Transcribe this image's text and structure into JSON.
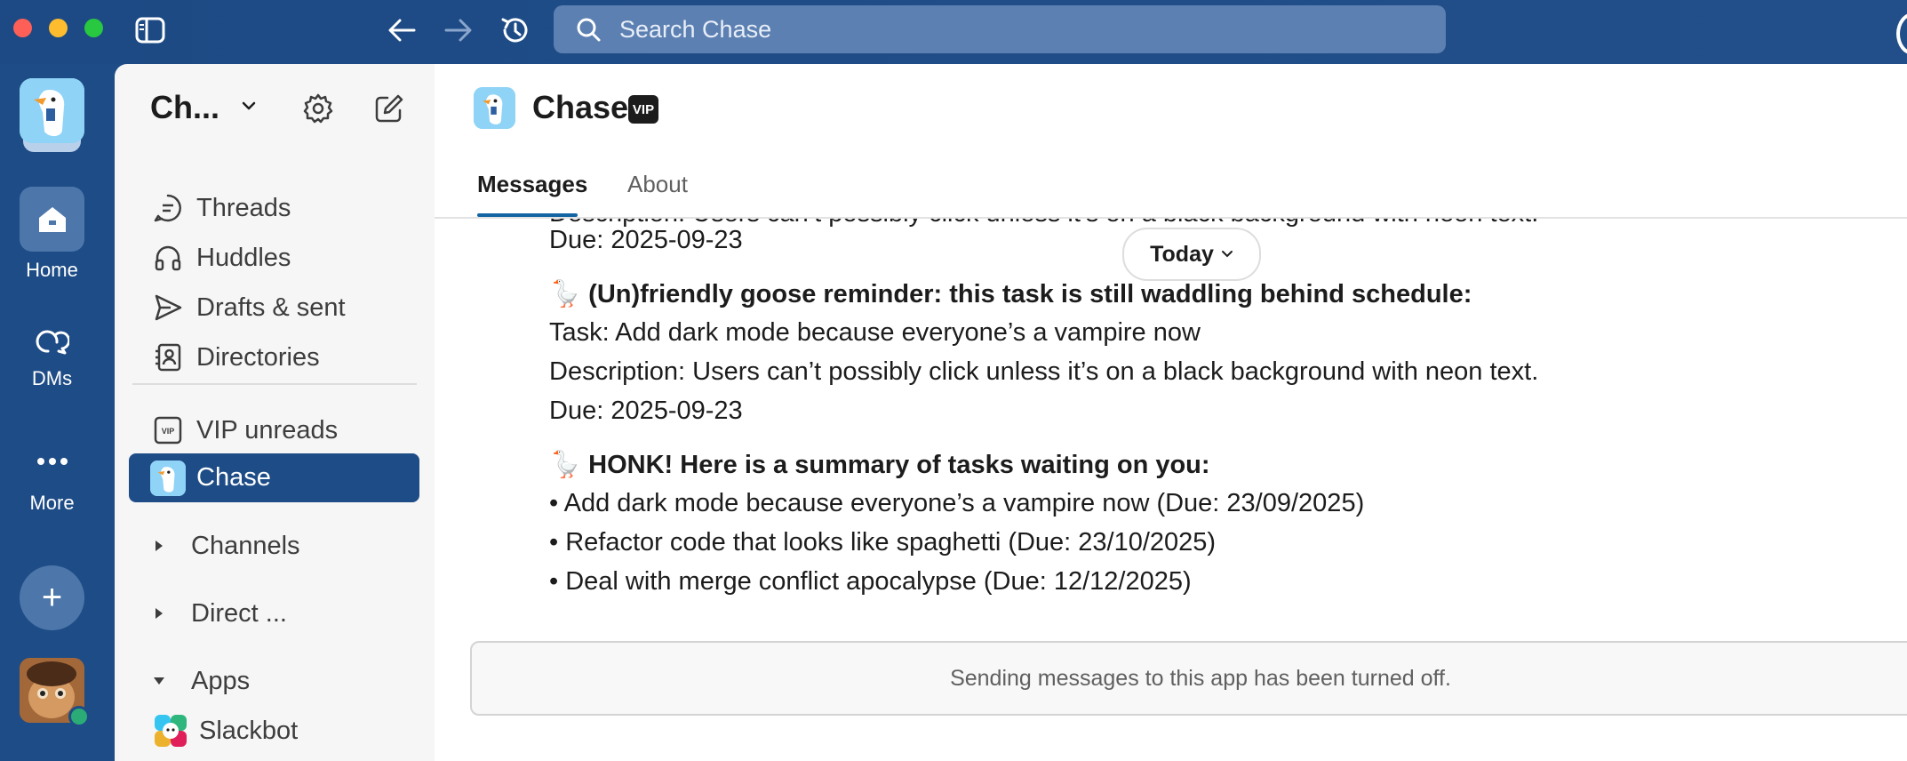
{
  "titlebar": {
    "search_placeholder": "Search Chase",
    "icons": [
      "sidebar-toggle-icon",
      "back-arrow-icon",
      "forward-arrow-icon",
      "history-icon",
      "search-icon"
    ]
  },
  "rail": {
    "home_label": "Home",
    "dms_label": "DMs",
    "more_label": "More",
    "add_symbol": "+"
  },
  "sidebar": {
    "workspace_name": "Ch...",
    "items": [
      {
        "label": "Threads",
        "icon": "threads-icon"
      },
      {
        "label": "Huddles",
        "icon": "headphones-icon"
      },
      {
        "label": "Drafts & sent",
        "icon": "send-icon"
      },
      {
        "label": "Directories",
        "icon": "directory-icon"
      }
    ],
    "vip_label": "VIP unreads",
    "vip_icon_text": "VIP",
    "active_item": "Chase",
    "sections": [
      {
        "label": "Channels",
        "expanded": false
      },
      {
        "label": "Direct ...",
        "expanded": false
      },
      {
        "label": "Apps",
        "expanded": true
      }
    ],
    "apps": [
      {
        "label": "Slackbot"
      }
    ]
  },
  "main": {
    "channel_title": "Chase",
    "vip_badge": "VIP",
    "tabs": [
      {
        "label": "Messages",
        "active": true
      },
      {
        "label": "About",
        "active": false
      }
    ],
    "today_label": "Today",
    "messages": [
      {
        "text": "Due: 2025-09-23"
      },
      {
        "emoji": "🪿",
        "text": "(Un)friendly goose reminder: this task is still waddling behind schedule:"
      },
      {
        "text": "Task: Add dark mode because everyone’s a vampire now"
      },
      {
        "text": "Description: Users can’t possibly click unless it’s on a black background with neon text."
      },
      {
        "text": "Due: 2025-09-23"
      },
      {
        "emoji": "🪿",
        "text": "HONK! Here is a summary of tasks waiting on you:"
      },
      {
        "text": "• Add dark mode because everyone’s a vampire now (Due: 23/09/2025)"
      },
      {
        "text": "• Refactor code that looks like spaghetti (Due: 23/10/2025)"
      },
      {
        "text": "• Deal with merge conflict apocalypse (Due: 12/12/2025)"
      }
    ],
    "composer_disabled_text": "Sending messages to this app has been turned off."
  },
  "colors": {
    "chrome": "#1e4c86",
    "sidebar_bg": "#f6f6f6",
    "active_item": "#1e4c86",
    "tab_underline": "#1264a3",
    "presence": "#2bac76"
  }
}
